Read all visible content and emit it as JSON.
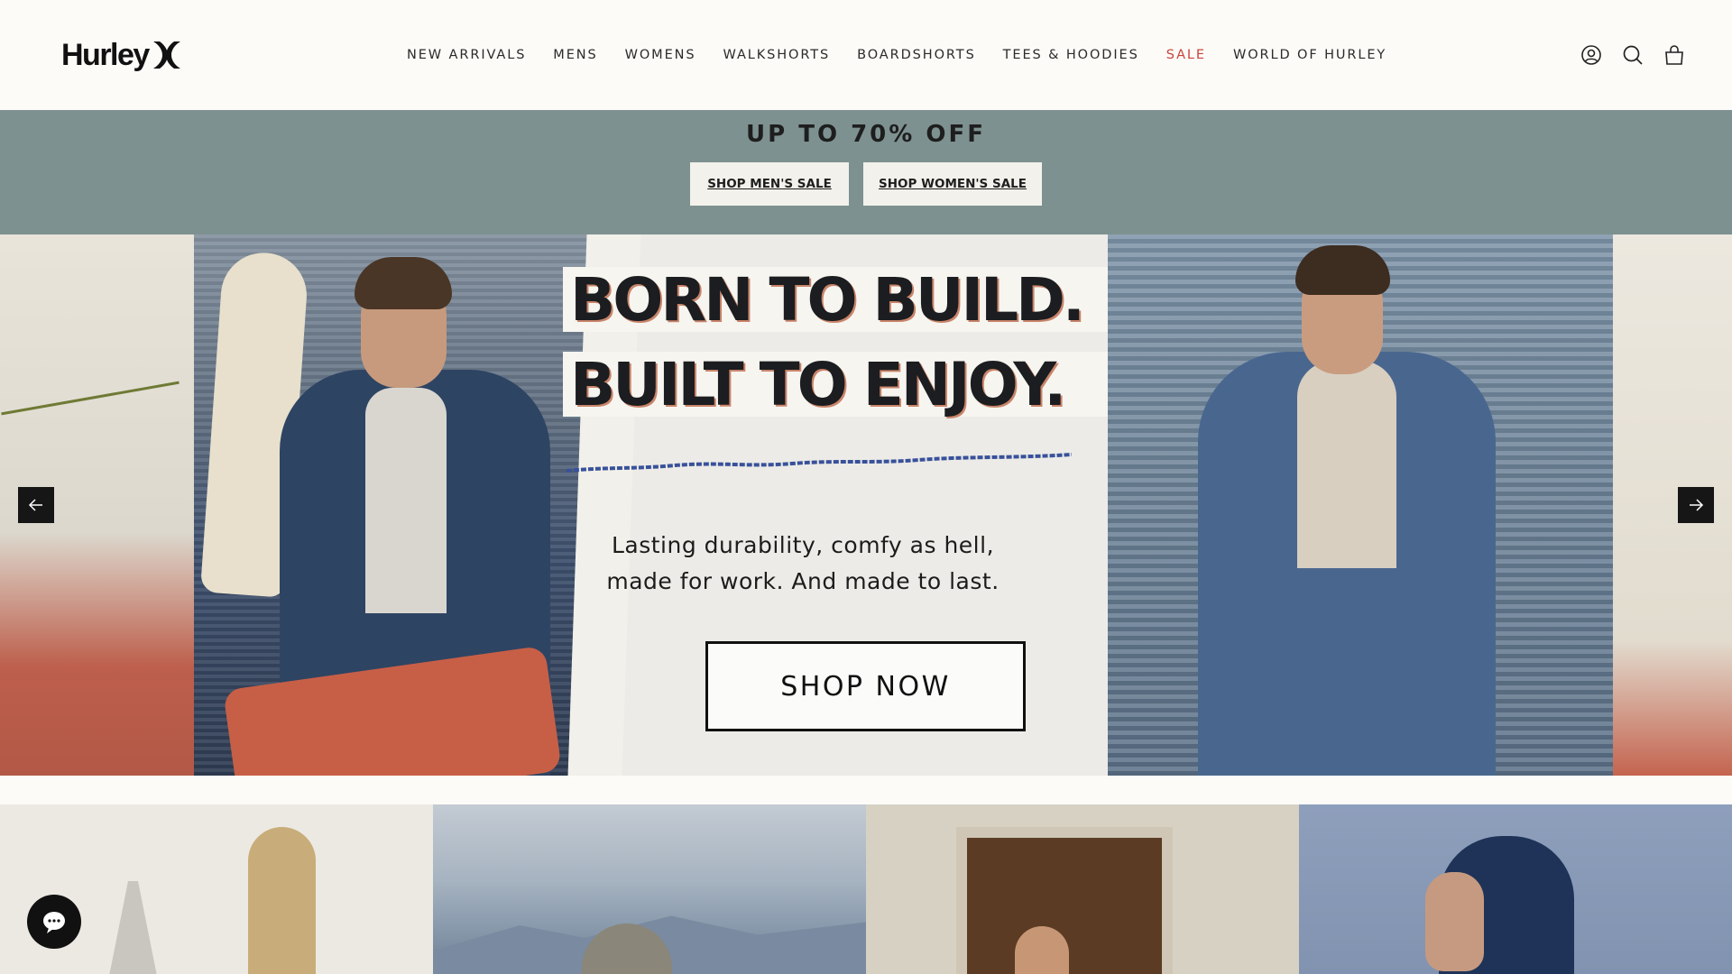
{
  "brand": {
    "name": "Hurley"
  },
  "nav": {
    "items": [
      {
        "label": "NEW ARRIVALS"
      },
      {
        "label": "MENS"
      },
      {
        "label": "WOMENS"
      },
      {
        "label": "WALKSHORTS"
      },
      {
        "label": "BOARDSHORTS"
      },
      {
        "label": "TEES & HOODIES"
      },
      {
        "label": "SALE"
      },
      {
        "label": "WORLD OF HURLEY"
      }
    ],
    "sale_color": "#c9453c"
  },
  "header_icons": [
    "account-icon",
    "search-icon",
    "cart-icon"
  ],
  "promo": {
    "title": "UP TO 70% OFF",
    "men_label": "SHOP MEN'S SALE",
    "women_label": "SHOP WOMEN'S SALE",
    "background": "#7d9190"
  },
  "hero": {
    "headline_1": "BORN TO BUILD.",
    "headline_2": "BUILT TO ENJOY.",
    "copy_line_1": "Lasting durability, comfy as hell,",
    "copy_line_2": "made for work. And made to last.",
    "cta": "SHOP NOW"
  },
  "carousel": {
    "prev_icon": "arrow-left-icon",
    "next_icon": "arrow-right-icon"
  },
  "chat": {
    "icon": "chat-bubble-icon"
  }
}
